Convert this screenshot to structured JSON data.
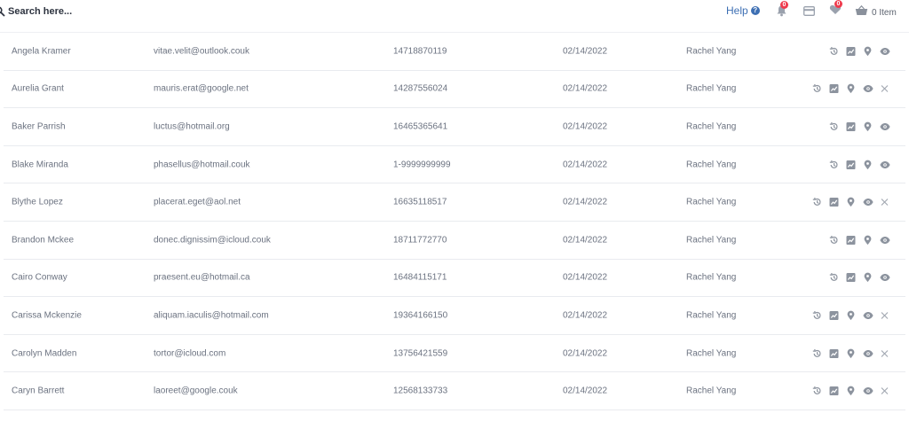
{
  "header": {
    "search": {
      "placeholder": "Search here...",
      "icon": "search-icon"
    },
    "help_label": "Help",
    "help_icon_glyph": "?",
    "notifications": {
      "count": "0",
      "icon": "bell-icon"
    },
    "card_icon": "credit-card-icon",
    "wishlist": {
      "count": "0",
      "icon": "heart-icon"
    },
    "cart": {
      "label": "0 Item",
      "icon": "basket-icon"
    },
    "colors": {
      "accent": "#3d6fb3",
      "badge": "#ef3b4d"
    }
  },
  "table": {
    "rows": [
      {
        "name": "Angela Kramer",
        "email": "vitae.velit@outlook.couk",
        "phone": "14718870119",
        "date": "02/14/2022",
        "agent": "Rachel Yang",
        "actions": [
          "history-icon",
          "chart-icon",
          "location-icon",
          "view-icon"
        ]
      },
      {
        "name": "Aurelia Grant",
        "email": "mauris.erat@google.net",
        "phone": "14287556024",
        "date": "02/14/2022",
        "agent": "Rachel Yang",
        "actions": [
          "history-icon",
          "chart-icon",
          "location-icon",
          "view-icon",
          "close-icon"
        ]
      },
      {
        "name": "Baker Parrish",
        "email": "luctus@hotmail.org",
        "phone": "16465365641",
        "date": "02/14/2022",
        "agent": "Rachel Yang",
        "actions": [
          "history-icon",
          "chart-icon",
          "location-icon",
          "view-icon"
        ]
      },
      {
        "name": "Blake Miranda",
        "email": "phasellus@hotmail.couk",
        "phone": "1-9999999999",
        "date": "02/14/2022",
        "agent": "Rachel Yang",
        "actions": [
          "history-icon",
          "chart-icon",
          "location-icon",
          "view-icon"
        ]
      },
      {
        "name": "Blythe Lopez",
        "email": "placerat.eget@aol.net",
        "phone": "16635118517",
        "date": "02/14/2022",
        "agent": "Rachel Yang",
        "actions": [
          "history-icon",
          "chart-icon",
          "location-icon",
          "view-icon",
          "close-icon"
        ]
      },
      {
        "name": "Brandon Mckee",
        "email": "donec.dignissim@icloud.couk",
        "phone": "18711772770",
        "date": "02/14/2022",
        "agent": "Rachel Yang",
        "actions": [
          "history-icon",
          "chart-icon",
          "location-icon",
          "view-icon"
        ]
      },
      {
        "name": "Cairo Conway",
        "email": "praesent.eu@hotmail.ca",
        "phone": "16484115171",
        "date": "02/14/2022",
        "agent": "Rachel Yang",
        "actions": [
          "history-icon",
          "chart-icon",
          "location-icon",
          "view-icon"
        ]
      },
      {
        "name": "Carissa Mckenzie",
        "email": "aliquam.iaculis@hotmail.com",
        "phone": "19364166150",
        "date": "02/14/2022",
        "agent": "Rachel Yang",
        "actions": [
          "history-icon",
          "chart-icon",
          "location-icon",
          "view-icon",
          "close-icon"
        ]
      },
      {
        "name": "Carolyn Madden",
        "email": "tortor@icloud.com",
        "phone": "13756421559",
        "date": "02/14/2022",
        "agent": "Rachel Yang",
        "actions": [
          "history-icon",
          "chart-icon",
          "location-icon",
          "view-icon",
          "close-icon"
        ]
      },
      {
        "name": "Caryn Barrett",
        "email": "laoreet@google.couk",
        "phone": "12568133733",
        "date": "02/14/2022",
        "agent": "Rachel Yang",
        "actions": [
          "history-icon",
          "chart-icon",
          "location-icon",
          "view-icon",
          "close-icon"
        ]
      }
    ]
  }
}
